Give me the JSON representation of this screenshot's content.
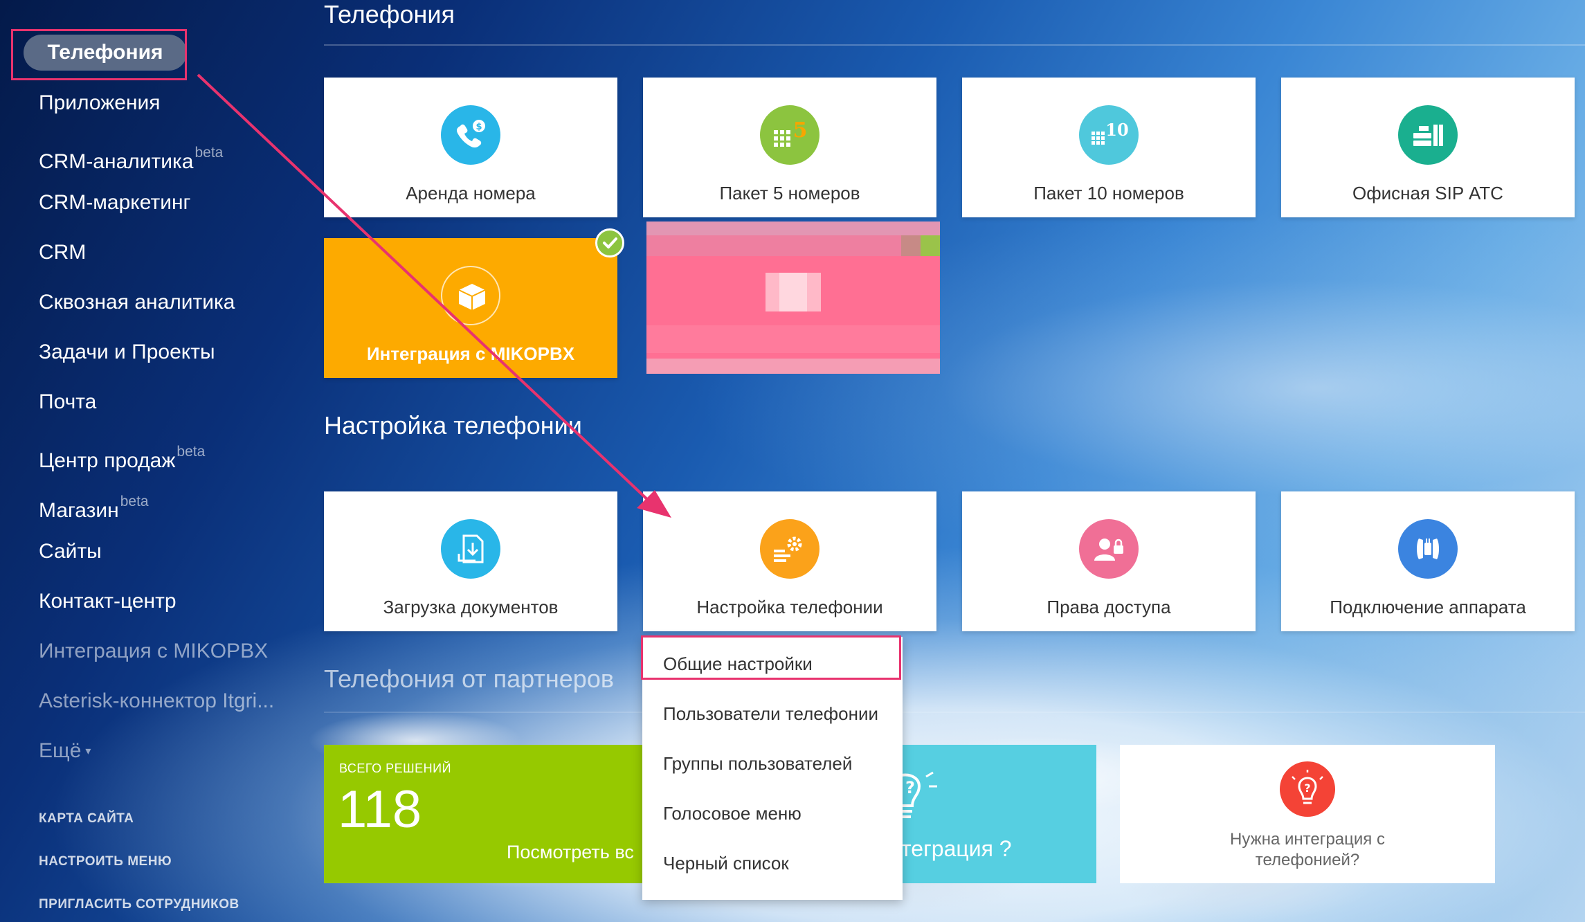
{
  "sidebar": {
    "active": "Телефония",
    "items": [
      {
        "label": "Приложения",
        "sup": ""
      },
      {
        "label": "CRM-аналитика",
        "sup": "beta"
      },
      {
        "label": "CRM-маркетинг",
        "sup": ""
      },
      {
        "label": "CRM",
        "sup": ""
      },
      {
        "label": "Сквозная аналитика",
        "sup": ""
      },
      {
        "label": "Задачи и Проекты",
        "sup": ""
      },
      {
        "label": "Почта",
        "sup": ""
      },
      {
        "label": "Центр продаж",
        "sup": "beta"
      },
      {
        "label": "Магазин",
        "sup": "beta"
      },
      {
        "label": "Сайты",
        "sup": ""
      },
      {
        "label": "Контакт-центр",
        "sup": ""
      },
      {
        "label": "Интеграция с MIKOPBX",
        "sup": ""
      },
      {
        "label": "Asterisk-коннектор Itgri...",
        "sup": ""
      },
      {
        "label": "Ещё",
        "sup": ""
      }
    ],
    "footer": [
      "КАРТА САЙТА",
      "НАСТРОИТЬ МЕНЮ",
      "ПРИГЛАСИТЬ СОТРУДНИКОВ"
    ]
  },
  "sections": {
    "telephony": "Телефония",
    "settings": "Настройка телефонии",
    "partners": "Телефония от партнеров"
  },
  "tiles_row1": [
    {
      "label": "Аренда номера",
      "icon": "phone-dollar-icon",
      "color": "#29b6e8"
    },
    {
      "label": "Пакет 5 номеров",
      "icon": "keypad-5-icon",
      "color": "#8cc43f"
    },
    {
      "label": "Пакет 10 номеров",
      "icon": "keypad-10-icon",
      "color": "#4fc8dc"
    },
    {
      "label": "Офисная SIP АТС",
      "icon": "pbx-icon",
      "color": "#1aaf8f"
    }
  ],
  "tiles_row2": [
    {
      "label": "Интеграция с MIKOPBX",
      "icon": "box-icon",
      "color": "#fdaa00"
    }
  ],
  "tiles_row3": [
    {
      "label": "Загрузка документов",
      "icon": "document-download-icon",
      "color": "#29b6e8"
    },
    {
      "label": "Настройка телефонии",
      "icon": "settings-gear-icon",
      "color": "#fba21a"
    },
    {
      "label": "Права доступа",
      "icon": "user-lock-icon",
      "color": "#f06f96"
    },
    {
      "label": "Подключение аппарата",
      "icon": "plug-phone-icon",
      "color": "#3b84e0"
    }
  ],
  "dropdown": {
    "items": [
      "Общие настройки",
      "Пользователи телефонии",
      "Группы пользователей",
      "Голосовое меню",
      "Черный список"
    ]
  },
  "partners": {
    "total_label": "ВСЕГО РЕШЕНИЙ",
    "total_value": "118",
    "view_all": "Посмотреть вс",
    "integration_text": "теграция ?",
    "need_integration": "Нужна интеграция с телефонией?"
  },
  "colors": {
    "annotation": "#e8336e",
    "green": "#96c900",
    "cyan": "#56cfe1",
    "orange": "#fdaa00"
  }
}
